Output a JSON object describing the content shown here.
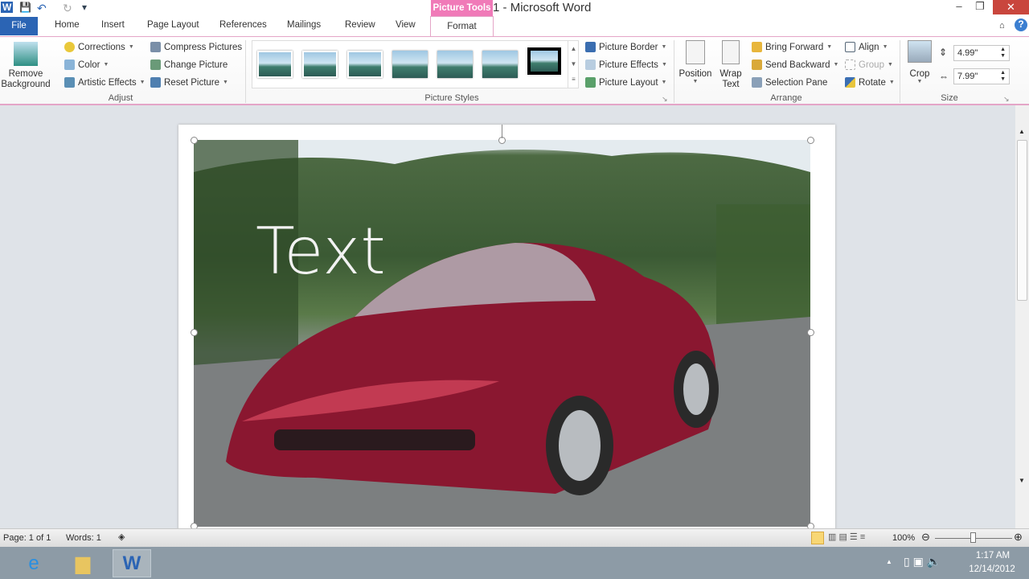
{
  "window": {
    "title": "Document1  -  Microsoft Word",
    "contextual_tab": "Picture Tools",
    "minimize": "–",
    "restore": "❐",
    "close": "✕"
  },
  "qat": {
    "app_icon": "W",
    "save": "💾",
    "undo": "↶",
    "redo": "↻",
    "customize": "▾"
  },
  "tabs": [
    "Home",
    "Insert",
    "Page Layout",
    "References",
    "Mailings",
    "Review",
    "View"
  ],
  "file_tab": "File",
  "format_tab": "Format",
  "ribbon": {
    "remove_background": "Remove Background",
    "adjust": {
      "label": "Adjust",
      "corrections": "Corrections",
      "color": "Color",
      "artistic_effects": "Artistic Effects",
      "compress": "Compress Pictures",
      "change": "Change Picture",
      "reset": "Reset Picture"
    },
    "styles": {
      "label": "Picture Styles",
      "border": "Picture Border",
      "effects": "Picture Effects",
      "layout": "Picture Layout"
    },
    "arrange": {
      "label": "Arrange",
      "position": "Position",
      "wrap_text": "Wrap Text",
      "bring_forward": "Bring Forward",
      "send_backward": "Send Backward",
      "selection_pane": "Selection Pane",
      "align": "Align",
      "group": "Group",
      "rotate": "Rotate"
    },
    "size": {
      "label": "Size",
      "crop": "Crop",
      "height": "4.99\"",
      "width": "7.99\""
    }
  },
  "document": {
    "overlay_text": "Text"
  },
  "status": {
    "page": "Page: 1 of 1",
    "words": "Words: 1",
    "zoom": "100%"
  },
  "taskbar": {
    "time": "1:17 AM",
    "date": "12/14/2012"
  }
}
